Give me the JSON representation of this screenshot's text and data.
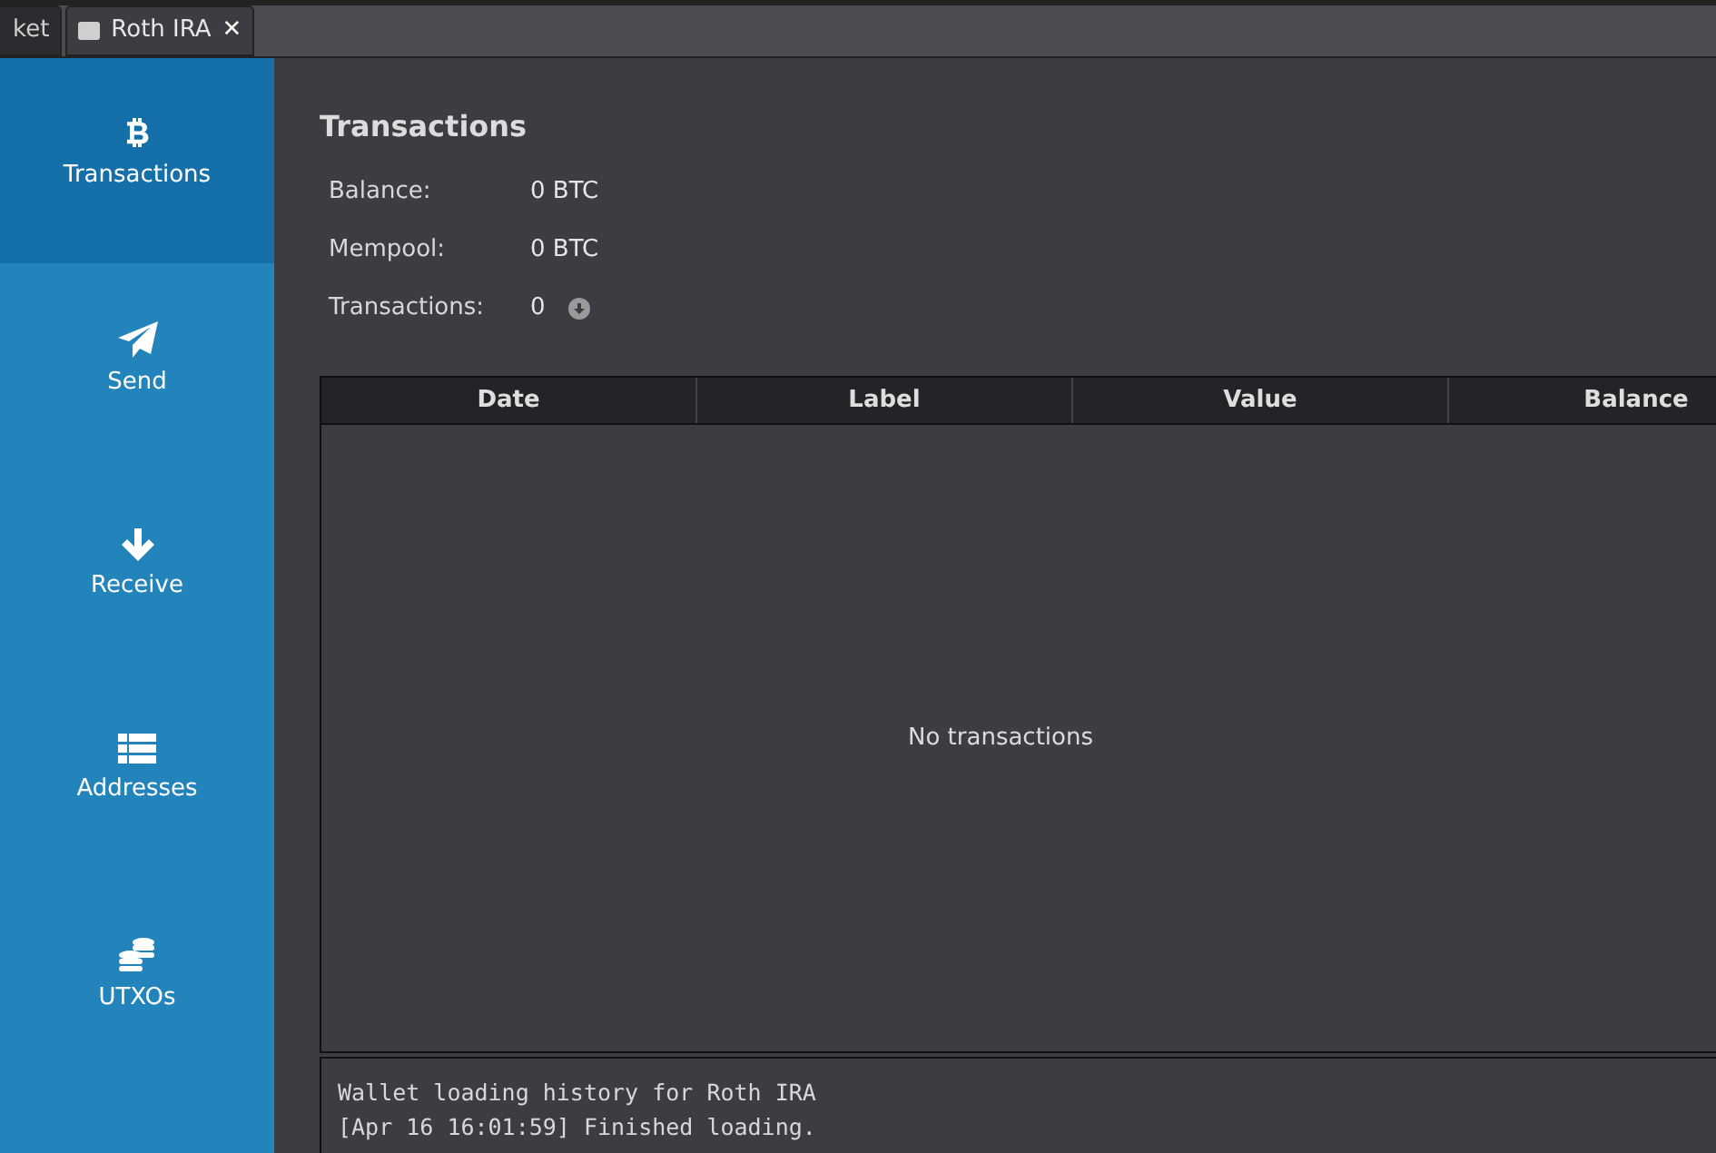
{
  "tabs": [
    {
      "label": "ket",
      "selected": false
    },
    {
      "label": "Roth IRA",
      "selected": true,
      "close": "✕"
    }
  ],
  "sidebar": {
    "items": [
      {
        "label": "Transactions",
        "kind": "bitcoin",
        "selected": true
      },
      {
        "label": "Send",
        "kind": "send",
        "selected": false
      },
      {
        "label": "Receive",
        "kind": "receive",
        "selected": false
      },
      {
        "label": "Addresses",
        "kind": "addresses",
        "selected": false
      },
      {
        "label": "UTXOs",
        "kind": "utxos",
        "selected": false
      }
    ]
  },
  "title": "Transactions",
  "summary": [
    {
      "label": "Balance:",
      "value": "0 BTC",
      "kind": "amount"
    },
    {
      "label": "Mempool:",
      "value": "0 BTC",
      "kind": "amount"
    },
    {
      "label": "Transactions:",
      "value": "0",
      "kind": "count"
    }
  ],
  "table": {
    "columns": [
      "Date",
      "Label",
      "Value",
      "Balance"
    ],
    "empty_message": "No transactions"
  },
  "log": [
    "Wallet loading history for Roth IRA",
    "[Apr 16 16:01:59] Finished loading."
  ]
}
